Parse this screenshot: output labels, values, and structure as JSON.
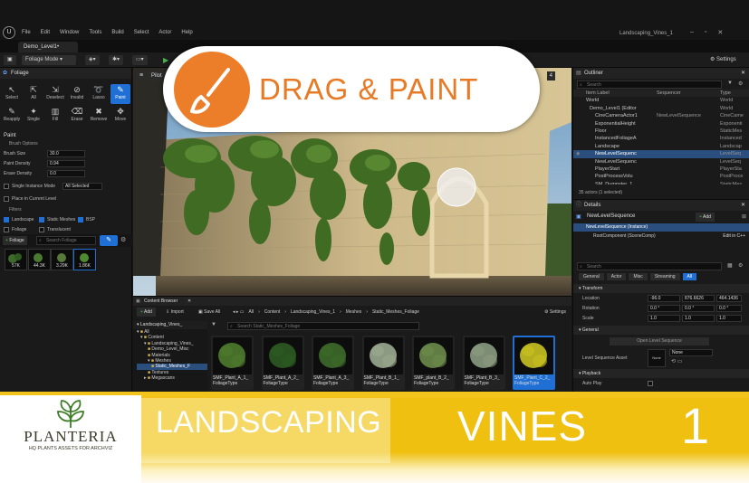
{
  "menubar": {
    "items": [
      "File",
      "Edit",
      "Window",
      "Tools",
      "Build",
      "Select",
      "Actor",
      "Help"
    ],
    "project": "Landscaping_Vines_1"
  },
  "tab": {
    "label": "Demo_Level1•"
  },
  "toolbar": {
    "mode": "Foliage Mode",
    "settings": "Settings"
  },
  "foliage_panel": {
    "title": "Foliage",
    "tools": [
      "Select",
      "All",
      "Deselect",
      "Invalid",
      "Lasso",
      "Paint",
      "Reapply",
      "Single",
      "Fill",
      "Erase",
      "Remove",
      "Move"
    ],
    "selected_tool": "Paint",
    "paint_header": "Paint",
    "brush_header": "Brush Options",
    "brush_size_label": "Brush Size",
    "brush_size": "30.0",
    "paint_density_label": "Paint Density",
    "paint_density": "0.94",
    "erase_density_label": "Erase Density",
    "erase_density": "0.0",
    "single_instance_label": "Single Instance Mode",
    "single_instance_value": "All Selected",
    "place_label": "Place in Current Level",
    "filters_header": "Filters",
    "filters": [
      "Landscape",
      "Static Meshes",
      "BSP",
      "Foliage",
      "Translucent"
    ],
    "foliage_button": "Foliage",
    "search_placeholder": "Search Foliage",
    "counts": [
      "57K",
      "44.3K",
      "3.29K",
      "1.86K"
    ]
  },
  "viewport": {
    "label": "Pilot",
    "count": "4"
  },
  "overlay": {
    "title": "DRAG & PAINT"
  },
  "outliner": {
    "title": "Outliner",
    "search_placeholder": "Search",
    "headers": [
      "Item Label",
      "Sequencer",
      "Type"
    ],
    "rows": [
      {
        "name": "World",
        "seq": "",
        "type": "World"
      },
      {
        "name": "Demo_Level1 (Editor",
        "seq": "",
        "type": "World"
      },
      {
        "name": "CineCameraActor1",
        "seq": "NewLevelSequence",
        "type": "CineCame"
      },
      {
        "name": "ExponentialHeight",
        "seq": "",
        "type": "Exponenti"
      },
      {
        "name": "Floor",
        "seq": "",
        "type": "StaticMes"
      },
      {
        "name": "InstancedFoliageA",
        "seq": "",
        "type": "Instanced"
      },
      {
        "name": "Landscape",
        "seq": "",
        "type": "Landscap"
      },
      {
        "name": "NewLevelSequenc",
        "seq": "",
        "type": "LevelSeq"
      },
      {
        "name": "NewLevelSequenc",
        "seq": "",
        "type": "LevelSeq"
      },
      {
        "name": "PlayerStart",
        "seq": "",
        "type": "PlayerSta"
      },
      {
        "name": "PostProcessVolu",
        "seq": "",
        "type": "PostProce"
      },
      {
        "name": "SM_Dumpster_1",
        "seq": "",
        "type": "StaticMes"
      }
    ],
    "footer": "35 actors (1 selected)"
  },
  "details": {
    "title": "Details",
    "object": "NewLevelSequence",
    "add": "Add",
    "instance": "NewLevelSequence (Instance)",
    "component": "RootComponent (SceneComp)",
    "edit_cpp": "Edit in C++",
    "search_placeholder": "Search",
    "tabs": [
      "General",
      "Actor",
      "Misc",
      "Streaming",
      "All"
    ],
    "transform_header": "Transform",
    "location_label": "Location",
    "location": [
      "-96.0",
      "876.6626",
      "464.1436"
    ],
    "rotation_label": "Rotation",
    "rotation": [
      "0.0 °",
      "0.0 °",
      "0.0 °"
    ],
    "scale_label": "Scale",
    "scale": [
      "1.0",
      "1.0",
      "1.0"
    ],
    "general_header": "General",
    "open_button": "Open Level Sequence",
    "asset_label": "Level Sequence Asset",
    "asset_value": "None",
    "asset_thumb": "None",
    "playback_header": "Playback",
    "autoplay_label": "Auto Play"
  },
  "content_browser": {
    "title": "Content Browser",
    "add": "Add",
    "import": "Import",
    "save_all": "Save All",
    "path": [
      "All",
      "Content",
      "Landscaping_Vines_1",
      "Meshes",
      "Static_Meshes_Foliage"
    ],
    "settings": "Settings",
    "tree_root": "Landscaping_Vines_",
    "tree": [
      "All",
      "Content",
      "Landscaping_Vines_",
      "Demo_Level_Misc",
      "Materials",
      "Meshes",
      "Static_Meshes_F",
      "Textures",
      "Megascans"
    ],
    "search_placeholder": "Search Static_Meshes_Foliage",
    "assets": [
      {
        "name": "SMF_Plant_A_1_",
        "type": "FoliageType"
      },
      {
        "name": "SMF_Plant_A_2_",
        "type": "FoliageType"
      },
      {
        "name": "SMF_Plant_A_3_",
        "type": "FoliageType"
      },
      {
        "name": "SMF_Plant_B_1_",
        "type": "FoliageType"
      },
      {
        "name": "SMF_plant_B_2_",
        "type": "FoliageType"
      },
      {
        "name": "SMF_Plant_B_3_",
        "type": "FoliageType"
      },
      {
        "name": "SMF_Plant_C_2_",
        "type": "FoliageType"
      }
    ]
  },
  "banner": {
    "brand": "PLANTERIA",
    "tagline": "HQ PLANTS ASSETS FOR ARCHVIZ",
    "title1": "LANDSCAPING",
    "title2": "VINES",
    "number": "1"
  }
}
